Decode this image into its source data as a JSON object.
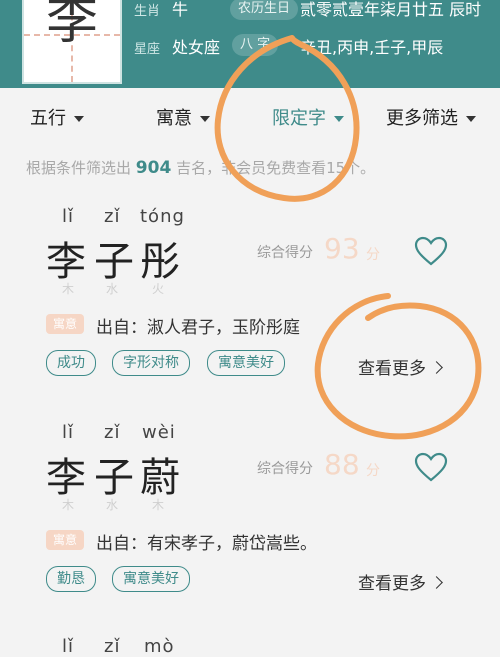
{
  "header": {
    "avatar_char": "李",
    "zodiac_label": "生肖",
    "zodiac_value": "牛",
    "lunar_label": "农历生日",
    "lunar_value": "贰零贰壹年柒月廿五 辰时",
    "star_label": "星座",
    "star_value": "处女座",
    "bazi_label": "八 字",
    "bazi_value": "辛丑,丙申,壬子,甲辰"
  },
  "filters": {
    "wuxing": "五行",
    "meaning": "寓意",
    "limit": "限定字",
    "more": "更多筛选"
  },
  "summary": {
    "prefix": "根据条件筛选出",
    "count": "904",
    "suffix": "吉名，非会员免费查看15个。"
  },
  "names": [
    {
      "pinyin": [
        "lǐ",
        "zǐ",
        "tóng"
      ],
      "chars": [
        "李",
        "子",
        "彤"
      ],
      "elements": [
        "木",
        "水",
        "火"
      ],
      "score_label": "综合得分",
      "score": "93",
      "score_unit": "分",
      "meaning_tag": "寓意",
      "source": "出自：淑人君子，玉阶彤庭",
      "tags": [
        "成功",
        "字形对称",
        "寓意美好"
      ],
      "more": "查看更多"
    },
    {
      "pinyin": [
        "lǐ",
        "zǐ",
        "wèi"
      ],
      "chars": [
        "李",
        "子",
        "蔚"
      ],
      "elements": [
        "木",
        "水",
        "木"
      ],
      "score_label": "综合得分",
      "score": "88",
      "score_unit": "分",
      "meaning_tag": "寓意",
      "source": "出自：有宋孝子，蔚岱嵩些。",
      "tags": [
        "勤恳",
        "寓意美好"
      ],
      "more": "查看更多"
    },
    {
      "pinyin": [
        "lǐ",
        "zǐ",
        "mò"
      ]
    }
  ],
  "colors": {
    "brand": "#3f8b8a",
    "annotation": "#f0a058",
    "score": "#f5d8c7"
  }
}
